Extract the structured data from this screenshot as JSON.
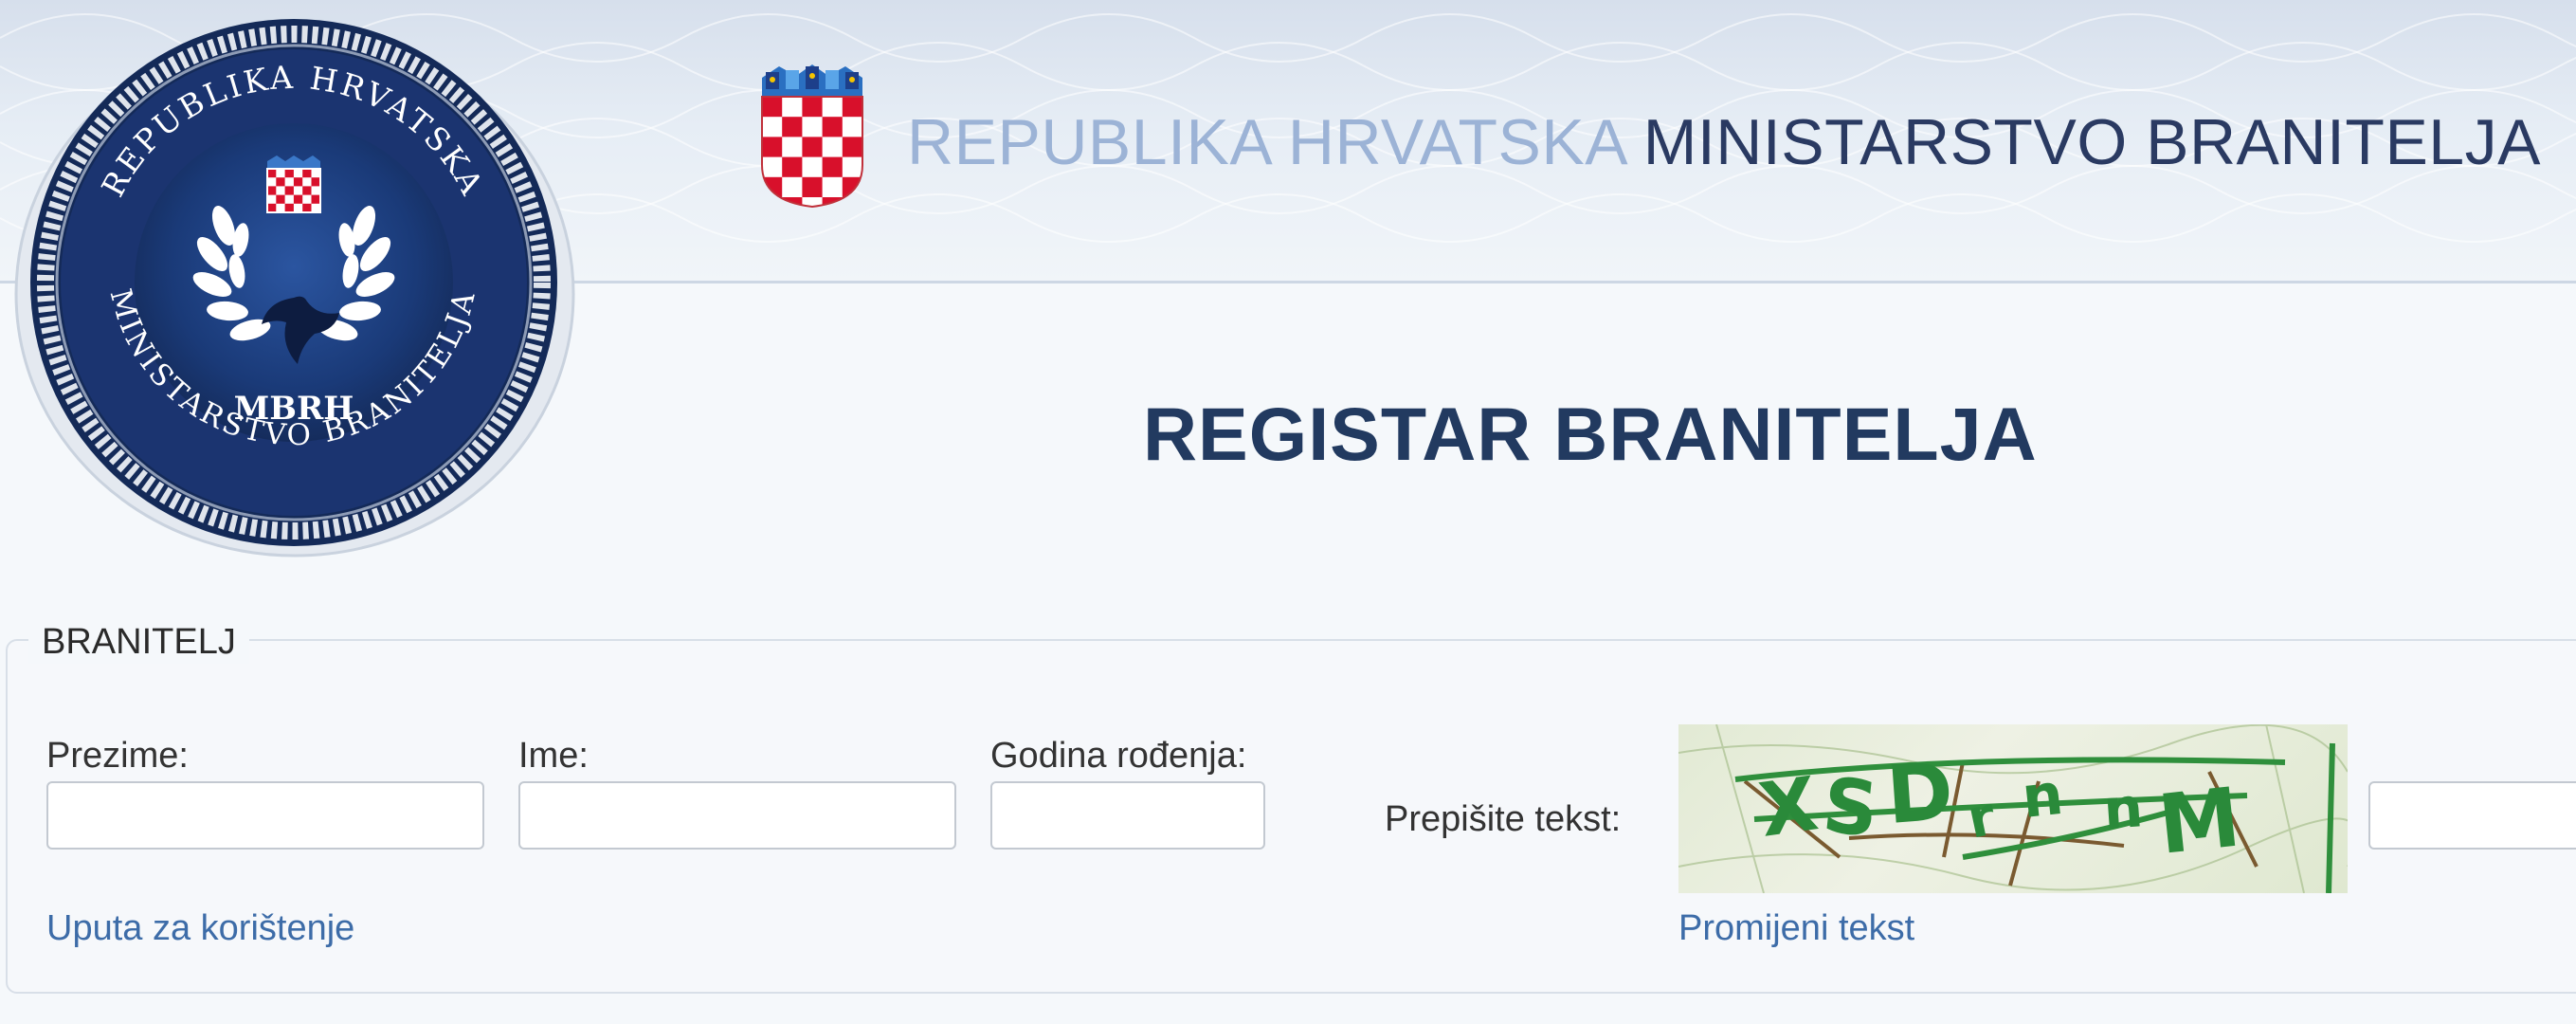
{
  "header": {
    "republika": "REPUBLIKA HRVATSKA",
    "ministarstvo": "MINISTARSTVO BRANITELJA"
  },
  "seal": {
    "abbreviation": "MBRH",
    "ring_top": "REPUBLIKA HRVATSKA",
    "ring_bottom": "MINISTARSTVO BRANITELJA"
  },
  "page": {
    "title": "REGISTAR BRANITELJA"
  },
  "form": {
    "legend": "BRANITELJ",
    "fields": {
      "surname_label": "Prezime:",
      "surname_value": "",
      "name_label": "Ime:",
      "name_value": "",
      "birth_year_label": "Godina rođenja:",
      "birth_year_value": "",
      "captcha_label": "Prepišite tekst:",
      "captcha_value": ""
    },
    "instructions_link": "Uputa za korištenje",
    "change_captcha_link": "Promijeni tekst"
  },
  "colors": {
    "navy": "#223a60",
    "light_blue_text": "#9cb3d6",
    "link": "#3d6ca8",
    "seal_blue": "#1f3d78",
    "captcha_green": "#2a8a3a"
  }
}
